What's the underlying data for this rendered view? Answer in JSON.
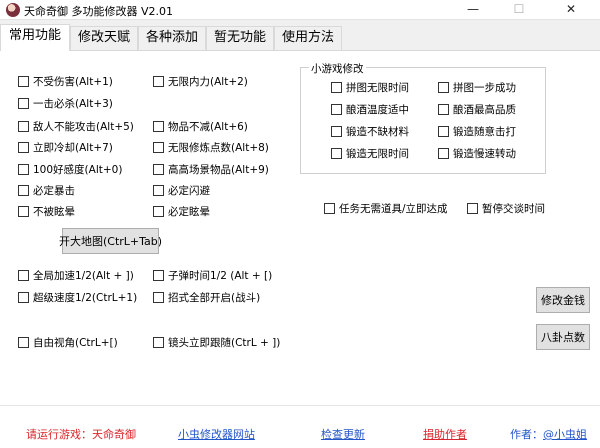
{
  "window": {
    "title": "天命奇御 多功能修改器  V2.01",
    "min_glyph": "—",
    "max_glyph": "☐",
    "close_glyph": "✕"
  },
  "tabs": [
    "常用功能",
    "修改天赋",
    "各种添加",
    "暂无功能",
    "使用方法"
  ],
  "left_col1": [
    "不受伤害(Alt+1)",
    "一击必杀(Alt+3)",
    "敌人不能攻击(Alt+5)",
    "立即冷却(Alt+7)",
    "100好感度(Alt+0)",
    "必定暴击",
    "不被眩晕"
  ],
  "left_col2": [
    "无限内力(Alt+2)",
    "物品不减(Alt+6)",
    "无限修炼点数(Alt+8)",
    "高高场景物品(Alt+9)",
    "必定闪避",
    "必定眩晕"
  ],
  "map_button": "开大地图(CtrL+Tab)",
  "speed_col1": [
    "全局加速1/2(Alt + ])",
    "超级速度1/2(CtrL+1)"
  ],
  "speed_col2": [
    "子弹时间1/2 (Alt + [)",
    "招式全部开启(战斗)"
  ],
  "camera": [
    "自由视角(CtrL+[)",
    "镜头立即跟随(CtrL + ])"
  ],
  "minigame": {
    "title": "小游戏修改",
    "items": [
      "拼图无限时间",
      "拼图一步成功",
      "酿酒温度适中",
      "酿酒最高品质",
      "锻造不缺材料",
      "锻造随意击打",
      "锻造无限时间",
      "锻造慢速转动"
    ]
  },
  "task_items": [
    "任务无需道具/立即达成",
    "暂停交谈时间"
  ],
  "buttons": {
    "money": "修改金钱",
    "bagua": "八卦点数"
  },
  "footer": {
    "run_game": "请运行游戏：天命奇御",
    "site": "小虫修改器网站",
    "update": "检查更新",
    "donate": "捐助作者",
    "author_prefix": "作者：",
    "author_name": "@小虫姐"
  }
}
